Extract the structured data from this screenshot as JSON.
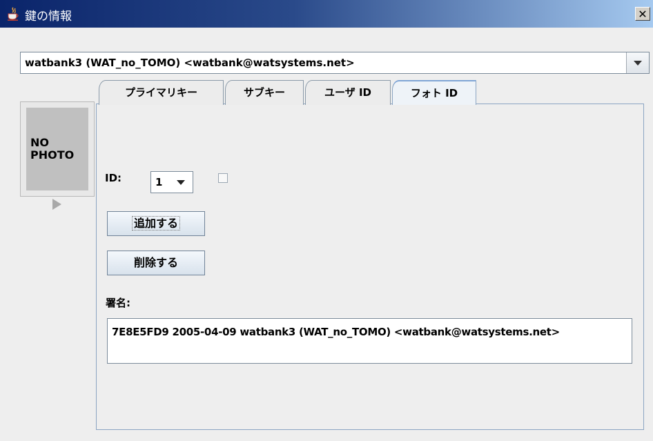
{
  "window": {
    "title": "鍵の情報"
  },
  "key_selector": {
    "value": "watbank3 (WAT_no_TOMO) <watbank@watsystems.net>"
  },
  "tabs": [
    {
      "label": "プライマリキー",
      "active": false
    },
    {
      "label": "サブキー",
      "active": false
    },
    {
      "label": "ユーザ ID",
      "active": false
    },
    {
      "label": "フォト ID",
      "active": true
    }
  ],
  "photo": {
    "placeholder": "NO\nPHOTO"
  },
  "photo_id": {
    "label": "ID:",
    "selected": "1"
  },
  "buttons": {
    "add": "追加する",
    "delete": "削除する"
  },
  "signatures": {
    "label": "署名:",
    "rows": [
      "7E8E5FD9 2005-04-09   watbank3 (WAT_no_TOMO) <watbank@watsystems.net>"
    ]
  },
  "icons": {
    "app": "java-cup-icon",
    "close": "close-icon",
    "dropdown": "chevron-down-icon",
    "next": "play-arrow-icon"
  }
}
